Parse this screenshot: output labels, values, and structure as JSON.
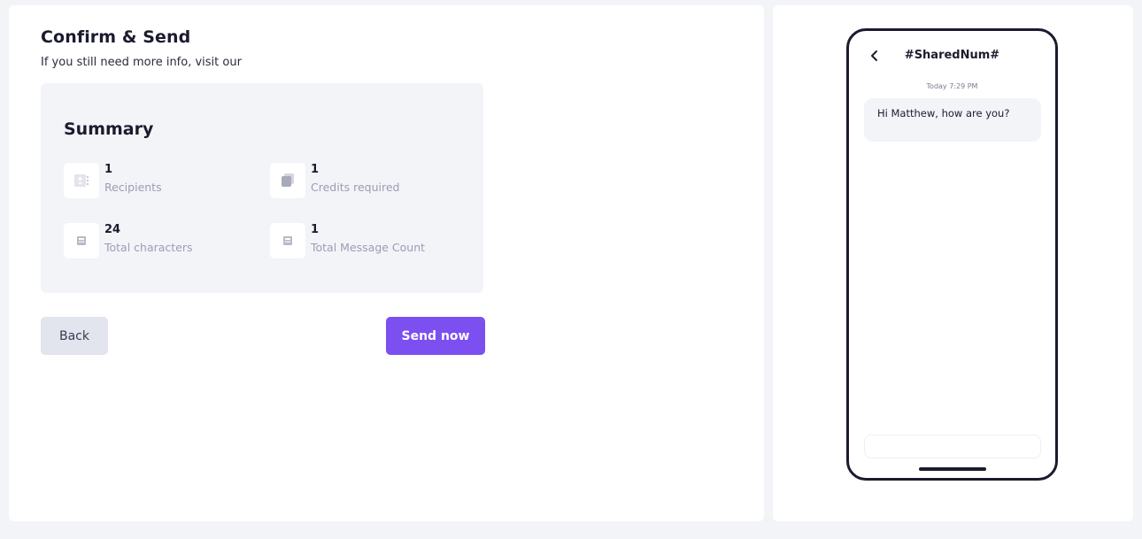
{
  "header": {
    "title": "Confirm & Send",
    "subtitle": "If you still need more info, visit our"
  },
  "summary": {
    "title": "Summary",
    "stats": [
      {
        "value": "1",
        "label": "Recipients",
        "icon": "contact-card-icon"
      },
      {
        "value": "1",
        "label": "Credits required",
        "icon": "credits-stack-icon"
      },
      {
        "value": "24",
        "label": "Total characters",
        "icon": "calculator-icon"
      },
      {
        "value": "1",
        "label": "Total Message Count",
        "icon": "calculator-icon"
      }
    ]
  },
  "actions": {
    "back_label": "Back",
    "send_label": "Send now"
  },
  "preview": {
    "contact": "#SharedNum#",
    "timestamp": "Today 7:29 PM",
    "message": "Hi Matthew, how are you?"
  },
  "colors": {
    "accent": "#7b4ff0",
    "background": "#f3f4f8",
    "text": "#1b1b2e",
    "muted": "#9a9db4"
  }
}
